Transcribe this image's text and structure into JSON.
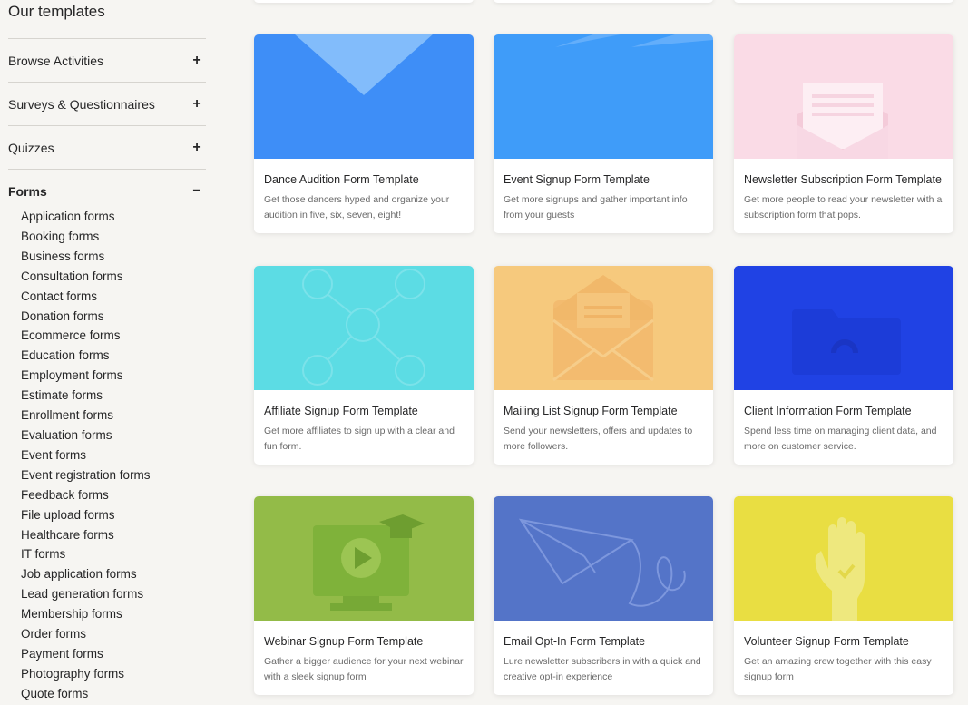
{
  "sidebar": {
    "title": "Our templates",
    "categories": [
      {
        "label": "Browse Activities",
        "toggle": "+"
      },
      {
        "label": "Surveys & Questionnaires",
        "toggle": "+"
      },
      {
        "label": "Quizzes",
        "toggle": "+"
      },
      {
        "label": "Forms",
        "toggle": "−"
      }
    ],
    "forms_items": [
      "Application forms",
      "Booking forms",
      "Business forms",
      "Consultation forms",
      "Contact forms",
      "Donation forms",
      "Ecommerce forms",
      "Education forms",
      "Employment forms",
      "Estimate forms",
      "Enrollment forms",
      "Evaluation forms",
      "Event forms",
      "Event registration forms",
      "Feedback forms",
      "File upload forms",
      "Healthcare forms",
      "IT forms",
      "Job application forms",
      "Lead generation forms",
      "Membership forms",
      "Order forms",
      "Payment forms",
      "Photography forms",
      "Quote forms"
    ]
  },
  "cards": [
    {
      "title": "Dance Audition Form Template",
      "desc": "Get those dancers hyped and organize your audition in five, six, seven, eight!",
      "color": "#3e8ef7",
      "icon": "dance-audition-illustration"
    },
    {
      "title": "Event Signup Form Template",
      "desc": "Get more signups and gather important info from your guests",
      "color": "#3f9cf9",
      "icon": "event-signup-illustration"
    },
    {
      "title": "Newsletter Subscription Form Template",
      "desc": "Get more people to read your newsletter with a subscription form that pops.",
      "color": "#fadbe6",
      "icon": "newsletter-envelope-illustration"
    },
    {
      "title": "Affiliate Signup Form Template",
      "desc": "Get more affiliates to sign up with a clear and fun form.",
      "color": "#5cdce4",
      "icon": "affiliate-network-illustration"
    },
    {
      "title": "Mailing List Signup Form Template",
      "desc": "Send your newsletters, offers and updates to more followers.",
      "color": "#f6c97d",
      "icon": "mailing-envelope-illustration"
    },
    {
      "title": "Client Information Form Template",
      "desc": "Spend less time on managing client data, and more on customer service.",
      "color": "#2042e4",
      "icon": "client-folder-illustration"
    },
    {
      "title": "Webinar Signup Form Template",
      "desc": "Gather a bigger audience for your next webinar with a sleek signup form",
      "color": "#93bb48",
      "icon": "webinar-monitor-illustration"
    },
    {
      "title": "Email Opt-In Form Template",
      "desc": "Lure newsletter subscribers in with a quick and creative opt-in experience",
      "color": "#5474c8",
      "icon": "paper-plane-illustration"
    },
    {
      "title": "Volunteer Signup Form Template",
      "desc": "Get an amazing crew together with this easy signup form",
      "color": "#e9de42",
      "icon": "volunteer-hand-illustration"
    }
  ]
}
